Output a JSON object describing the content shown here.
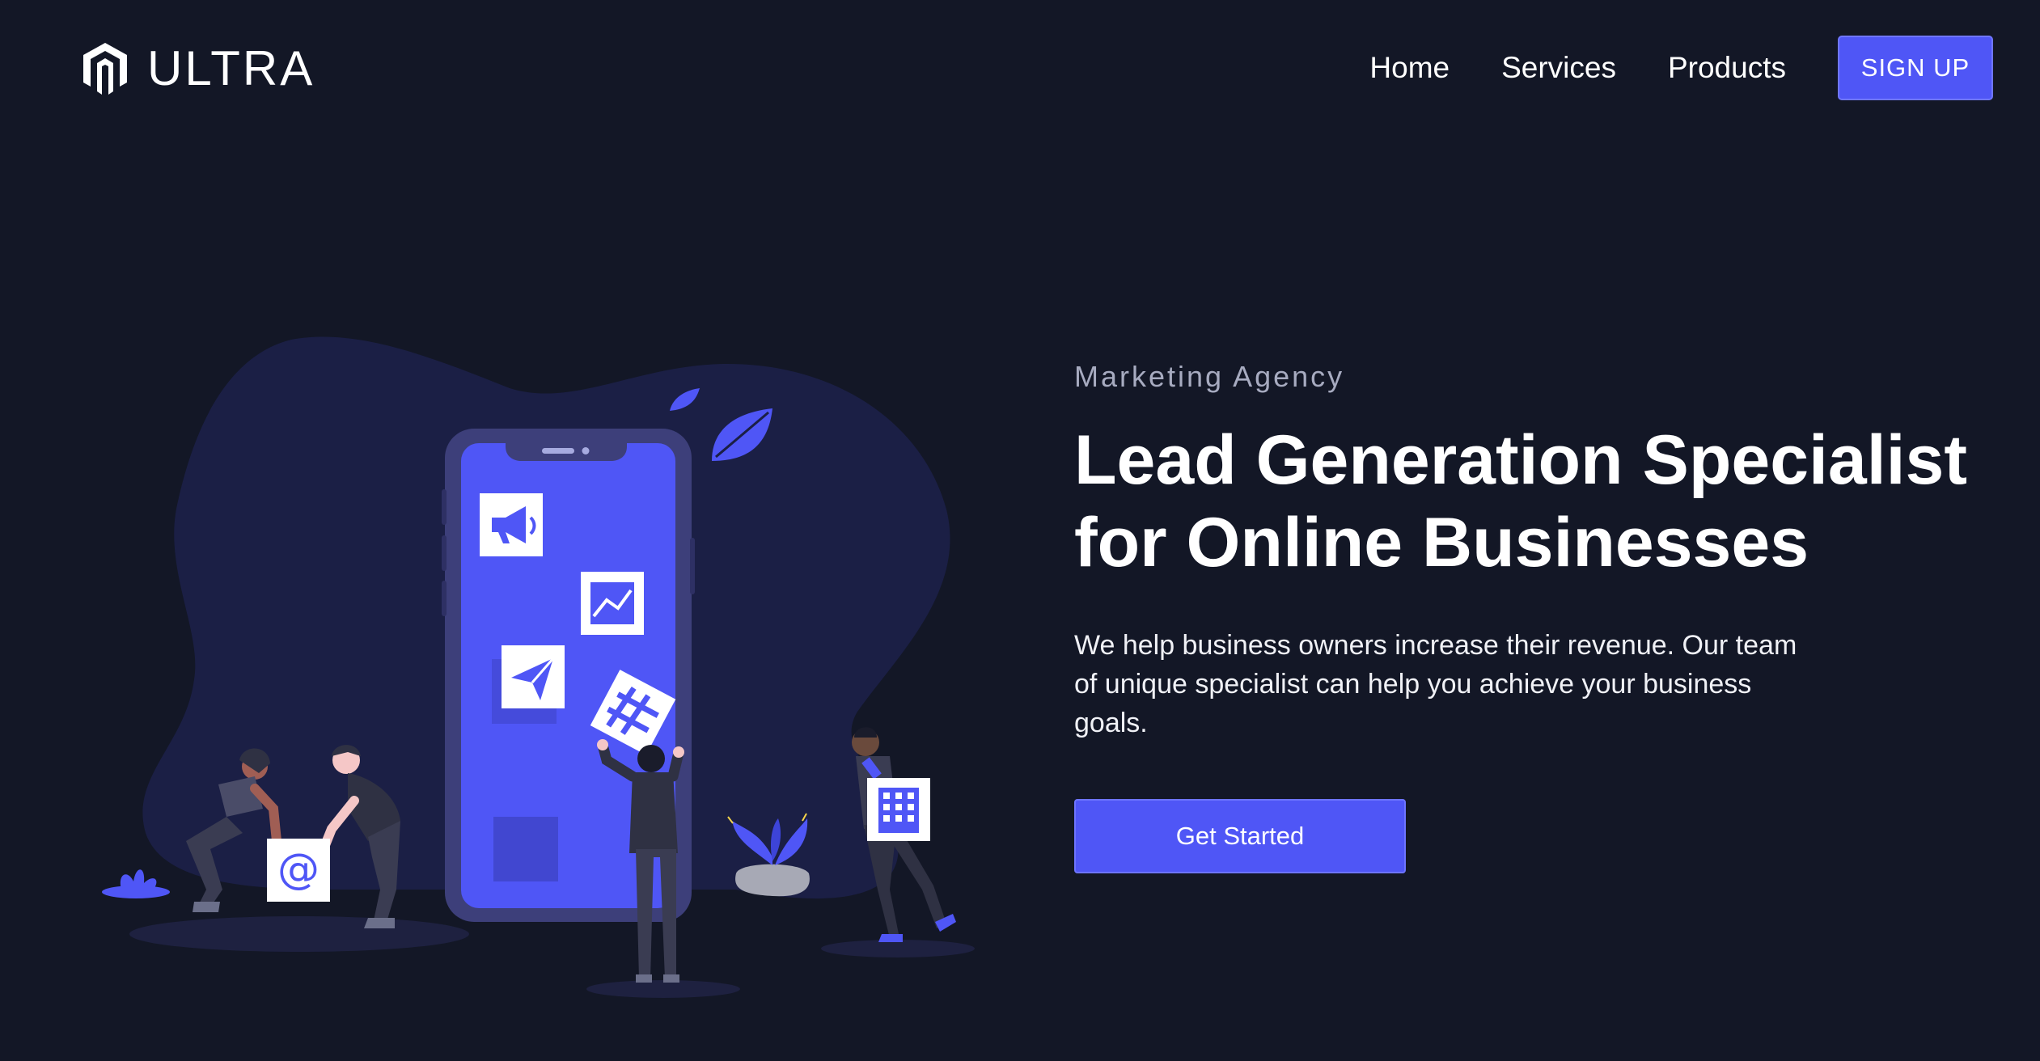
{
  "brand": {
    "logo_icon": "hexagon-m-icon",
    "name": "ULTRA"
  },
  "nav": {
    "items": [
      {
        "label": "Home"
      },
      {
        "label": "Services"
      },
      {
        "label": "Products"
      }
    ],
    "signup_label": "SIGN UP"
  },
  "hero": {
    "eyebrow": "Marketing Agency",
    "headline_line1": "Lead Generation Specialist",
    "headline_line2": "for Online Businesses",
    "description": "We help business owners increase their revenue. Our team of unique specialist can help you achieve your business goals.",
    "cta_label": "Get Started"
  },
  "illustration": {
    "icons": [
      "megaphone-icon",
      "chart-icon",
      "paper-plane-icon",
      "hashtag-icon",
      "building-icon",
      "at-sign-icon",
      "leaf-icon"
    ]
  },
  "colors": {
    "background": "#131726",
    "accent": "#4f56f6",
    "blob": "#1b1f45",
    "text_muted": "#a7abc0"
  }
}
